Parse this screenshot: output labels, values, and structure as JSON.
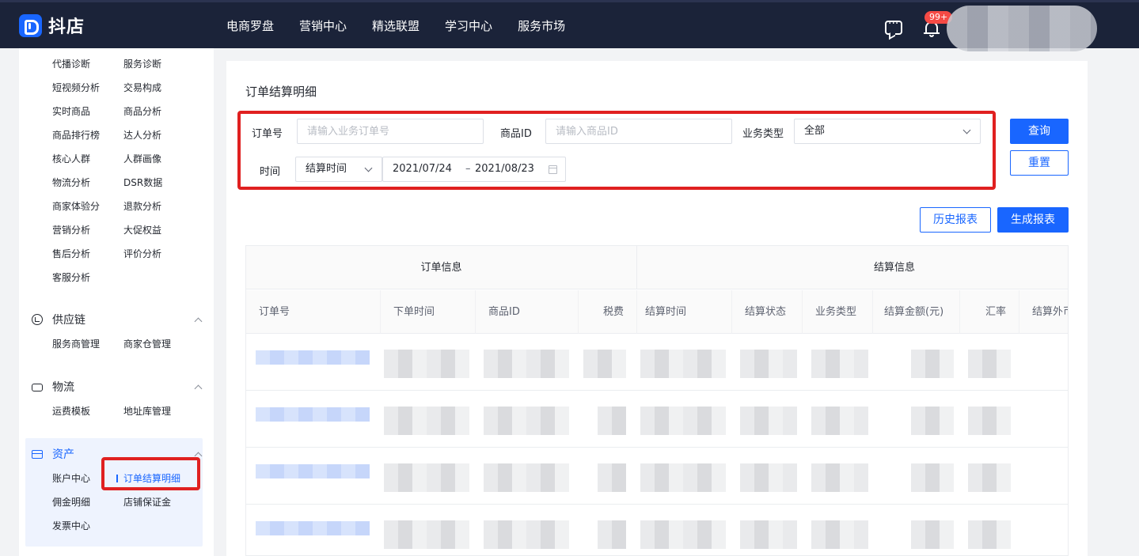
{
  "brand": {
    "name": "抖店"
  },
  "nav": [
    "电商罗盘",
    "营销中心",
    "精选联盟",
    "学习中心",
    "服务市场"
  ],
  "notifications": {
    "badge": "99+"
  },
  "sidebar": {
    "analysis_items": [
      "代播诊断",
      "服务诊断",
      "短视频分析",
      "交易构成",
      "实时商品",
      "商品分析",
      "商品排行榜",
      "达人分析",
      "核心人群",
      "人群画像",
      "物流分析",
      "DSR数据",
      "商家体验分",
      "退款分析",
      "营销分析",
      "大促权益",
      "售后分析",
      "评价分析",
      "客服分析"
    ],
    "supply": {
      "title": "供应链",
      "items": [
        "服务商管理",
        "商家仓管理"
      ]
    },
    "logistics": {
      "title": "物流",
      "items": [
        "运费模板",
        "地址库管理"
      ]
    },
    "assets": {
      "title": "资产",
      "items": [
        "账户中心",
        "订单结算明细",
        "佣金明细",
        "店铺保证金",
        "发票中心"
      ],
      "active": "订单结算明细"
    }
  },
  "page": {
    "title": "订单结算明细",
    "filters": {
      "order_no_label": "订单号",
      "order_no_placeholder": "请输入业务订单号",
      "product_id_label": "商品ID",
      "product_id_placeholder": "请输入商品ID",
      "biz_type_label": "业务类型",
      "biz_type_value": "全部",
      "time_label": "时间",
      "time_type_value": "结算时间",
      "date_start": "2021/07/24",
      "date_sep": "–",
      "date_end": "2021/08/23"
    },
    "buttons": {
      "query": "查询",
      "reset": "重置",
      "history": "历史报表",
      "generate": "生成报表"
    },
    "table": {
      "groups": [
        "订单信息",
        "结算信息"
      ],
      "columns": [
        "订单号",
        "下单时间",
        "商品ID",
        "税费",
        "结算时间",
        "结算状态",
        "业务类型",
        "结算金额(元)",
        "汇率",
        "结算外币"
      ]
    }
  },
  "colors": {
    "primary": "#1966ff",
    "topbar": "#1b2339",
    "highlight": "#e02020"
  }
}
